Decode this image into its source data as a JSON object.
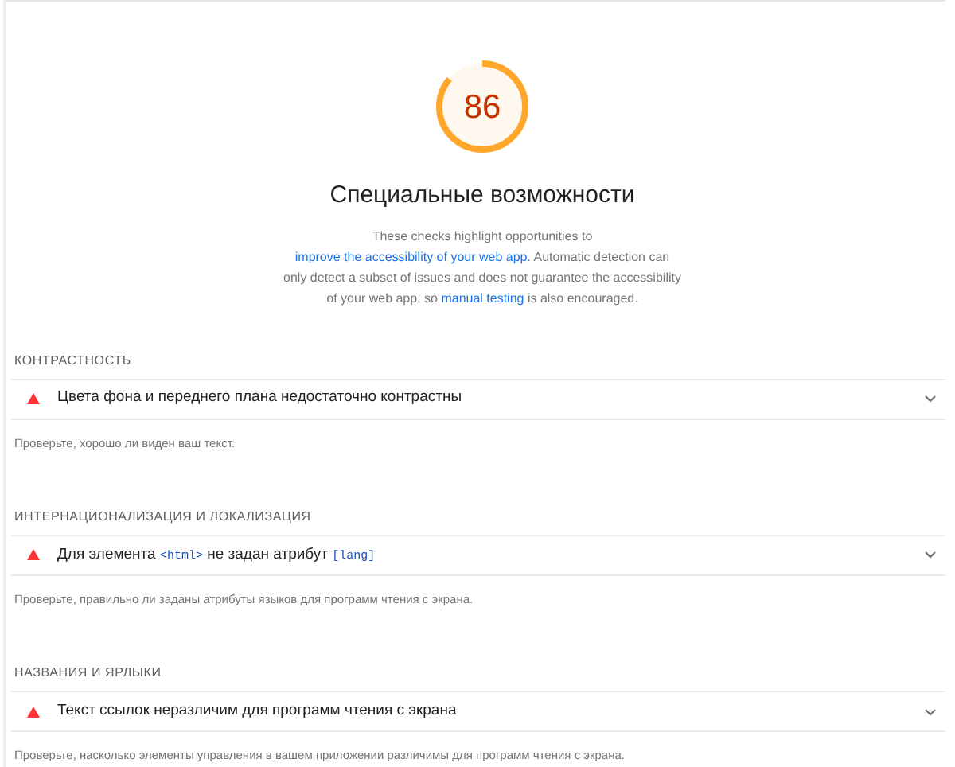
{
  "gauge": {
    "score": "86"
  },
  "title": "Специальные возможности",
  "description": [
    {
      "kind": "text",
      "text": "These checks highlight opportunities to "
    },
    {
      "kind": "link",
      "text": "improve the accessibility of your web app"
    },
    {
      "kind": "text",
      "text": ". Automatic detection can only detect a subset of issues and does not guarantee the accessibility of your web app, so "
    },
    {
      "kind": "link",
      "text": "manual testing"
    },
    {
      "kind": "text",
      "text": " is also encouraged."
    }
  ],
  "groups": [
    {
      "heading": "КОНТРАСТНОСТЬ",
      "audits": [
        {
          "title": [
            {
              "kind": "text",
              "text": "Цвета фона и переднего плана недостаточно контрастны"
            }
          ],
          "expanded": false
        }
      ],
      "description": "Проверьте, хорошо ли виден ваш текст."
    },
    {
      "heading": "ИНТЕРНАЦИОНАЛИЗАЦИЯ И ЛОКАЛИЗАЦИЯ",
      "audits": [
        {
          "title": [
            {
              "kind": "text",
              "text": "Для элемента "
            },
            {
              "kind": "code",
              "text": "<html>"
            },
            {
              "kind": "text",
              "text": " не задан атрибут "
            },
            {
              "kind": "code",
              "text": "[lang]"
            }
          ],
          "expanded": false
        }
      ],
      "description": "Проверьте, правильно ли заданы атрибуты языков для программ чтения с экрана."
    },
    {
      "heading": "НАЗВАНИЯ И ЯРЛЫКИ",
      "audits": [
        {
          "title": [
            {
              "kind": "text",
              "text": "Текст ссылок неразличим для программ чтения с экрана"
            }
          ],
          "expanded": false
        }
      ],
      "description": "Проверьте, насколько элементы управления в вашем приложении различимы для программ чтения с экрана."
    }
  ]
}
